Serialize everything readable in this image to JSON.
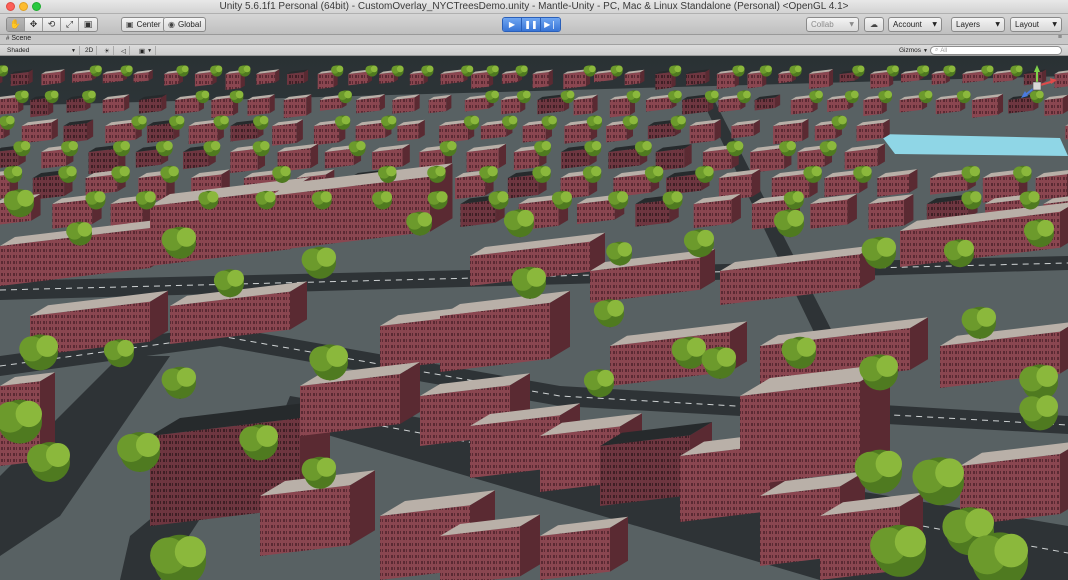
{
  "window": {
    "title": "Unity 5.6.1f1 Personal (64bit) - CustomOverlay_NYCTreesDemo.unity - Mantle-Unity - PC, Mac & Linux Standalone (Personal) <OpenGL 4.1>"
  },
  "toolbar": {
    "tools": [
      {
        "name": "hand-tool",
        "icon": "hand-icon",
        "glyph": "✋"
      },
      {
        "name": "move-tool",
        "icon": "move-icon",
        "glyph": "✥"
      },
      {
        "name": "rotate-tool",
        "icon": "rotate-icon",
        "glyph": "⟲"
      },
      {
        "name": "scale-tool",
        "icon": "scale-icon",
        "glyph": "⤢"
      },
      {
        "name": "rect-tool",
        "icon": "rect-icon",
        "glyph": "▣"
      }
    ],
    "pivot_label": "Center",
    "space_label": "Global",
    "collab_label": "Collab",
    "account_label": "Account",
    "layers_label": "Layers",
    "layout_label": "Layout"
  },
  "scene_tab": {
    "label": "Scene"
  },
  "scene_bar": {
    "shading_mode": "Shaded",
    "mode_2d_label": "2D",
    "gizmos_label": "Gizmos",
    "search_placeholder": "All"
  },
  "colors": {
    "play_blue": "#3874d6",
    "brick": "#8a4650",
    "roof": "#b9b0a8",
    "tree": "#6c9a2c",
    "road": "#2e3336",
    "water": "#8fd6e6"
  }
}
